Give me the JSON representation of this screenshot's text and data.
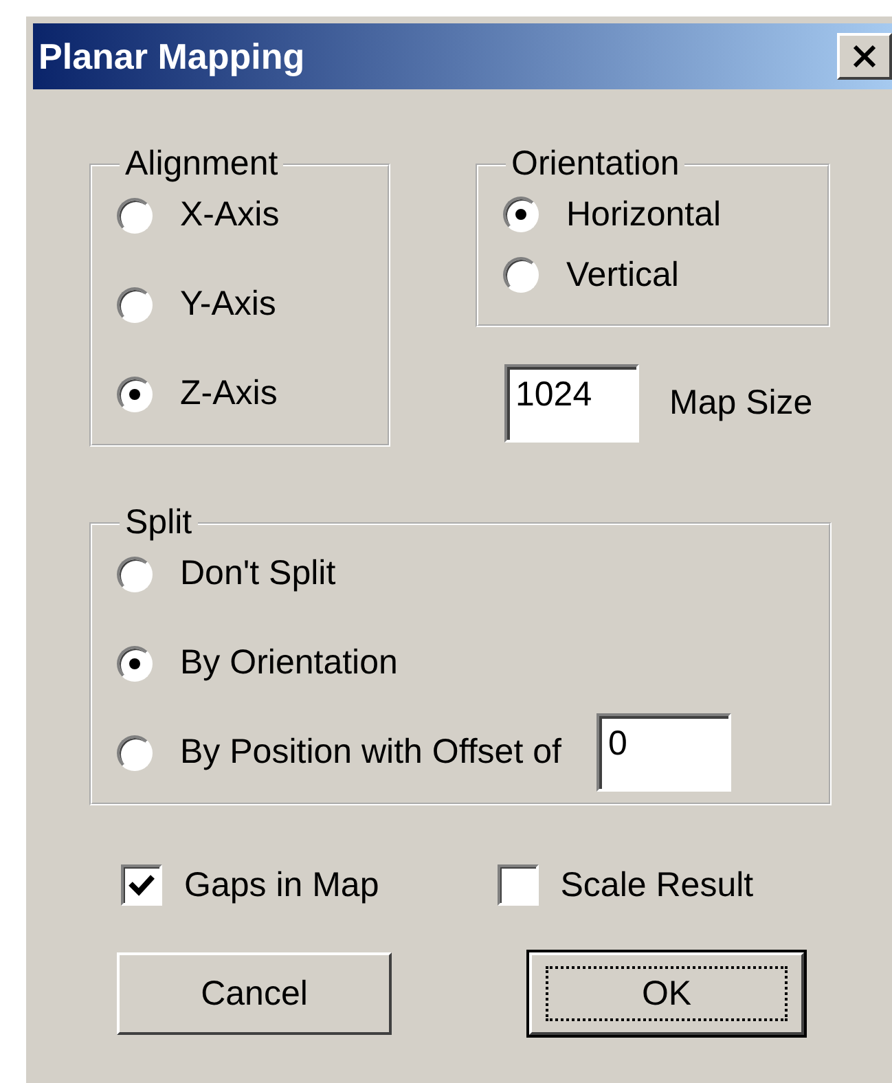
{
  "window": {
    "title": "Planar Mapping"
  },
  "alignment": {
    "label": "Alignment",
    "options": [
      {
        "label": "X-Axis",
        "selected": false
      },
      {
        "label": "Y-Axis",
        "selected": false
      },
      {
        "label": "Z-Axis",
        "selected": true
      }
    ]
  },
  "orientation": {
    "label": "Orientation",
    "options": [
      {
        "label": "Horizontal",
        "selected": true
      },
      {
        "label": "Vertical",
        "selected": false
      }
    ]
  },
  "map_size": {
    "value": "1024",
    "label": "Map Size"
  },
  "split": {
    "label": "Split",
    "offset_value": "0",
    "options": [
      {
        "label": "Don't Split",
        "selected": false
      },
      {
        "label": "By Orientation",
        "selected": true
      },
      {
        "label": "By Position with Offset of",
        "selected": false
      }
    ]
  },
  "checkboxes": [
    {
      "label": "Gaps in Map",
      "checked": true
    },
    {
      "label": "Scale Result",
      "checked": false
    }
  ],
  "buttons": [
    {
      "label": "Cancel",
      "default": false
    },
    {
      "label": "OK",
      "default": true
    }
  ]
}
